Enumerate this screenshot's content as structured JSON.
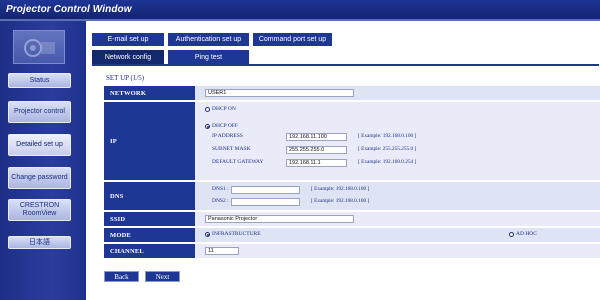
{
  "window": {
    "title": "Projector Control Window"
  },
  "sidebar": {
    "items": [
      {
        "label": "Status",
        "active": false
      },
      {
        "label": "Projector control",
        "active": false
      },
      {
        "label": "Detailed set up",
        "active": true
      },
      {
        "label": "Change password",
        "active": false
      },
      {
        "label": "CRESTRON RoomView",
        "active": false
      },
      {
        "label": "日本語",
        "active": false
      }
    ]
  },
  "tabs": {
    "row1": [
      "E-mail set up",
      "Authentication set up",
      "Command port set up"
    ],
    "row2": [
      "Network config",
      "Ping test"
    ],
    "active": "Network config"
  },
  "setup": {
    "label": "SET UP (1/5)"
  },
  "form": {
    "network": {
      "label": "NETWORK",
      "value": "USER1"
    },
    "ip": {
      "label": "IP",
      "dhcp_on_label": "DHCP ON",
      "dhcp_off_label": "DHCP OFF",
      "selected": "DHCP OFF",
      "ip_address_label": "IP ADDRESS",
      "ip_address_value": "192.168.11.100",
      "ip_address_hint": "[ Example: 192.168.0.100 ]",
      "subnet_label": "SUBNET MASK",
      "subnet_value": "255.255.255.0",
      "subnet_hint": "[ Example: 255.255.255.0 ]",
      "gateway_label": "DEFAULT GATEWAY",
      "gateway_value": "192.168.11.1",
      "gateway_hint": "[ Example: 192.168.0.254 ]"
    },
    "dns": {
      "label": "DNS",
      "dns1_label": "DNS1 :",
      "dns1_value": "",
      "dns1_hint": "[ Example: 192.168.0.100 ]",
      "dns2_label": "DNS2 :",
      "dns2_value": "",
      "dns2_hint": "[ Example: 192.168.0.100 ]"
    },
    "ssid": {
      "label": "SSID",
      "value": "Panasonic Projector"
    },
    "mode": {
      "label": "MODE",
      "infrastructure_label": "INFRASTRUCTURE",
      "adhoc_label": "AD HOC",
      "selected": "INFRASTRUCTURE"
    },
    "channel": {
      "label": "CHANNEL",
      "value": "11"
    }
  },
  "nav": {
    "back_label": "Back",
    "next_label": "Next"
  },
  "colors": {
    "accent": "#1f3794",
    "title_bar": "#1a2d85",
    "row_bg": "#dfe4f4"
  }
}
